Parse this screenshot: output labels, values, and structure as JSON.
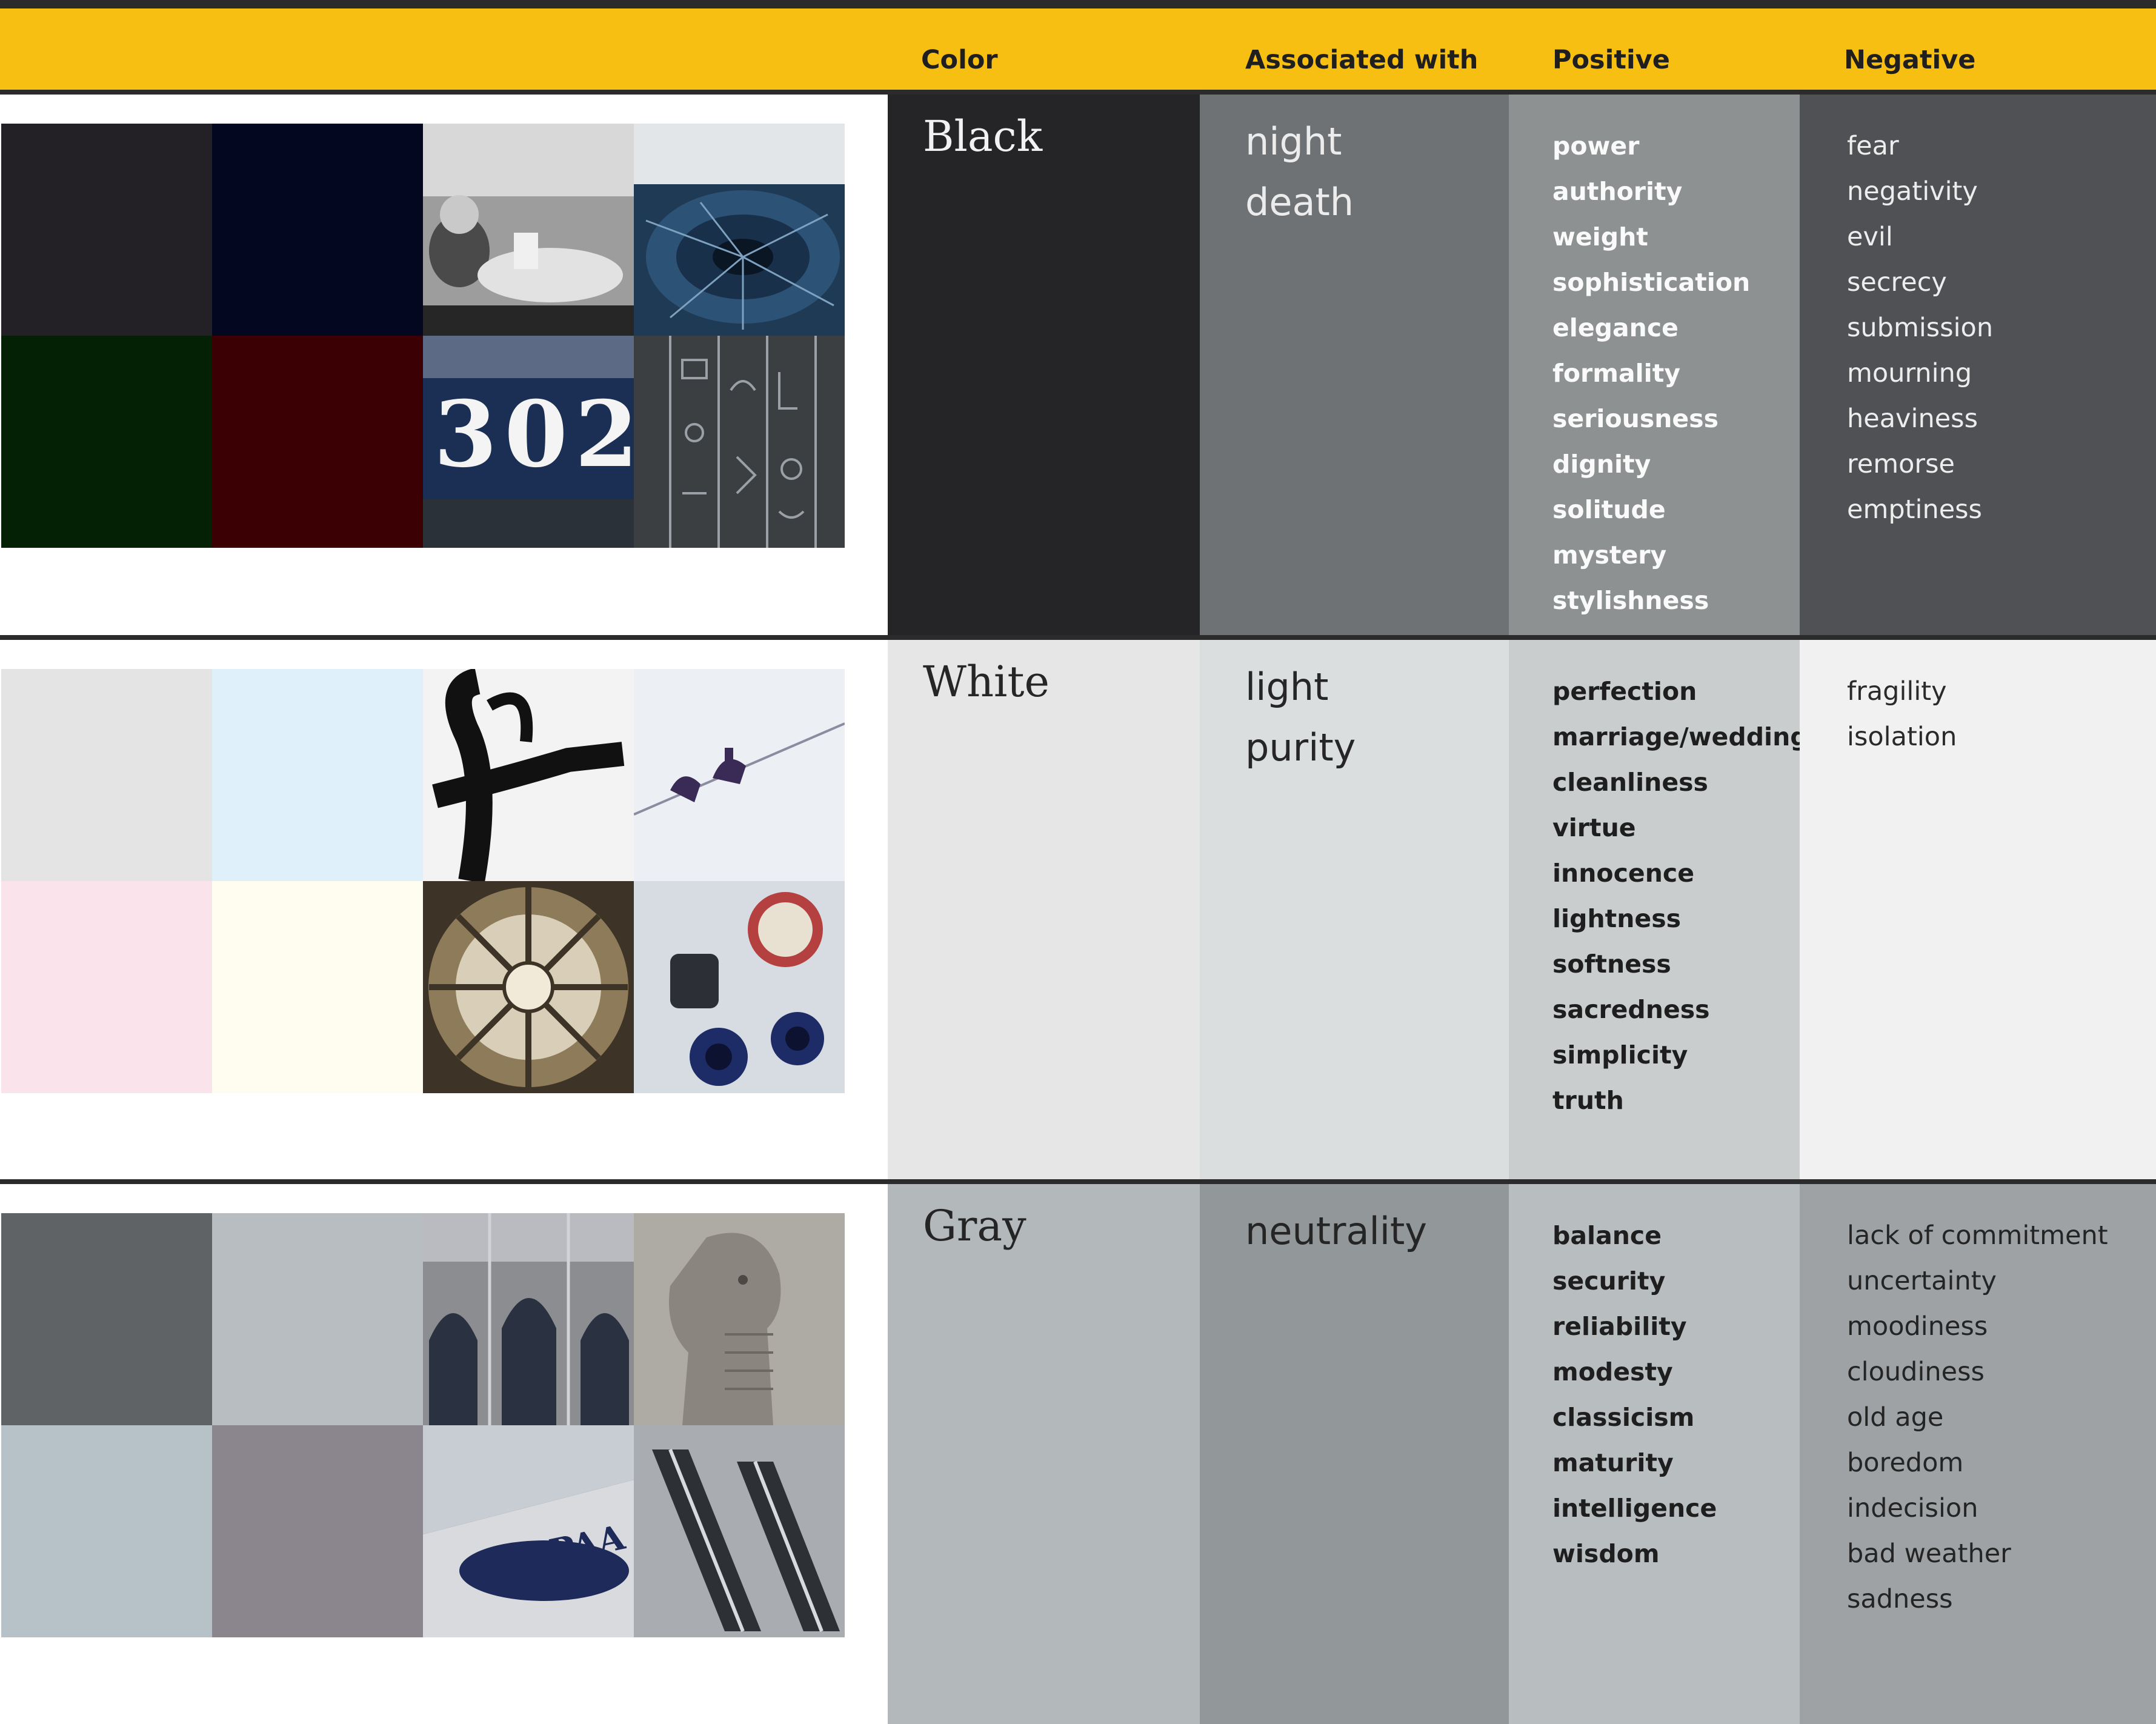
{
  "header": {
    "color_label": "Color",
    "associated_label": "Associated with",
    "positive_label": "Positive",
    "negative_label": "Negative"
  },
  "sections": [
    {
      "name": "Black",
      "swatches": [
        "#232125",
        "#03071f",
        "#052105",
        "#3a0004"
      ],
      "photo_text": "302",
      "associated": [
        "night",
        "death"
      ],
      "positive": [
        "power",
        "authority",
        "weight",
        "sophistication",
        "elegance",
        "formality",
        "seriousness",
        "dignity",
        "solitude",
        "mystery",
        "stylishness"
      ],
      "negative": [
        "fear",
        "negativity",
        "evil",
        "secrecy",
        "submission",
        "mourning",
        "heaviness",
        "remorse",
        "emptiness"
      ],
      "column_colors": [
        "#252427",
        "#6e7274",
        "#8d9192",
        "#505154"
      ],
      "text_colors": [
        "#f2f2f2",
        "#ececec",
        "#fafafa",
        "#ededed"
      ]
    },
    {
      "name": "White",
      "swatches": [
        "#e4e4e4",
        "#dff0fa",
        "#fbe3ec",
        "#fefdf0"
      ],
      "photo_text": "",
      "associated": [
        "light",
        "purity"
      ],
      "positive": [
        "perfection",
        "marriage/wedding",
        "cleanliness",
        "virtue",
        "innocence",
        "lightness",
        "softness",
        "sacredness",
        "simplicity",
        "truth"
      ],
      "negative": [
        "fragility",
        "isolation"
      ],
      "column_colors": [
        "#e6e6e6",
        "#dadedf",
        "#c9cdce",
        "#f1f1f1"
      ],
      "text_colors": [
        "#262626",
        "#262626",
        "#1e1e1e",
        "#2a2a2a"
      ]
    },
    {
      "name": "Gray",
      "swatches": [
        "#5f6366",
        "#b7bdc0",
        "#b6c2c8",
        "#8b868d"
      ],
      "photo_text": "PAA",
      "associated": [
        "neutrality"
      ],
      "positive": [
        "balance",
        "security",
        "reliability",
        "modesty",
        "classicism",
        "maturity",
        "intelligence",
        "wisdom"
      ],
      "negative": [
        "lack of commitment",
        "uncertainty",
        "moodiness",
        "cloudiness",
        "old age",
        "boredom",
        "indecision",
        "bad weather",
        "sadness"
      ],
      "column_colors": [
        "#b3b8bb",
        "#929899",
        "#b8bdbf",
        "#9ea2a4"
      ],
      "text_colors": [
        "#252525",
        "#252525",
        "#1e1e1e",
        "#242424"
      ]
    }
  ]
}
